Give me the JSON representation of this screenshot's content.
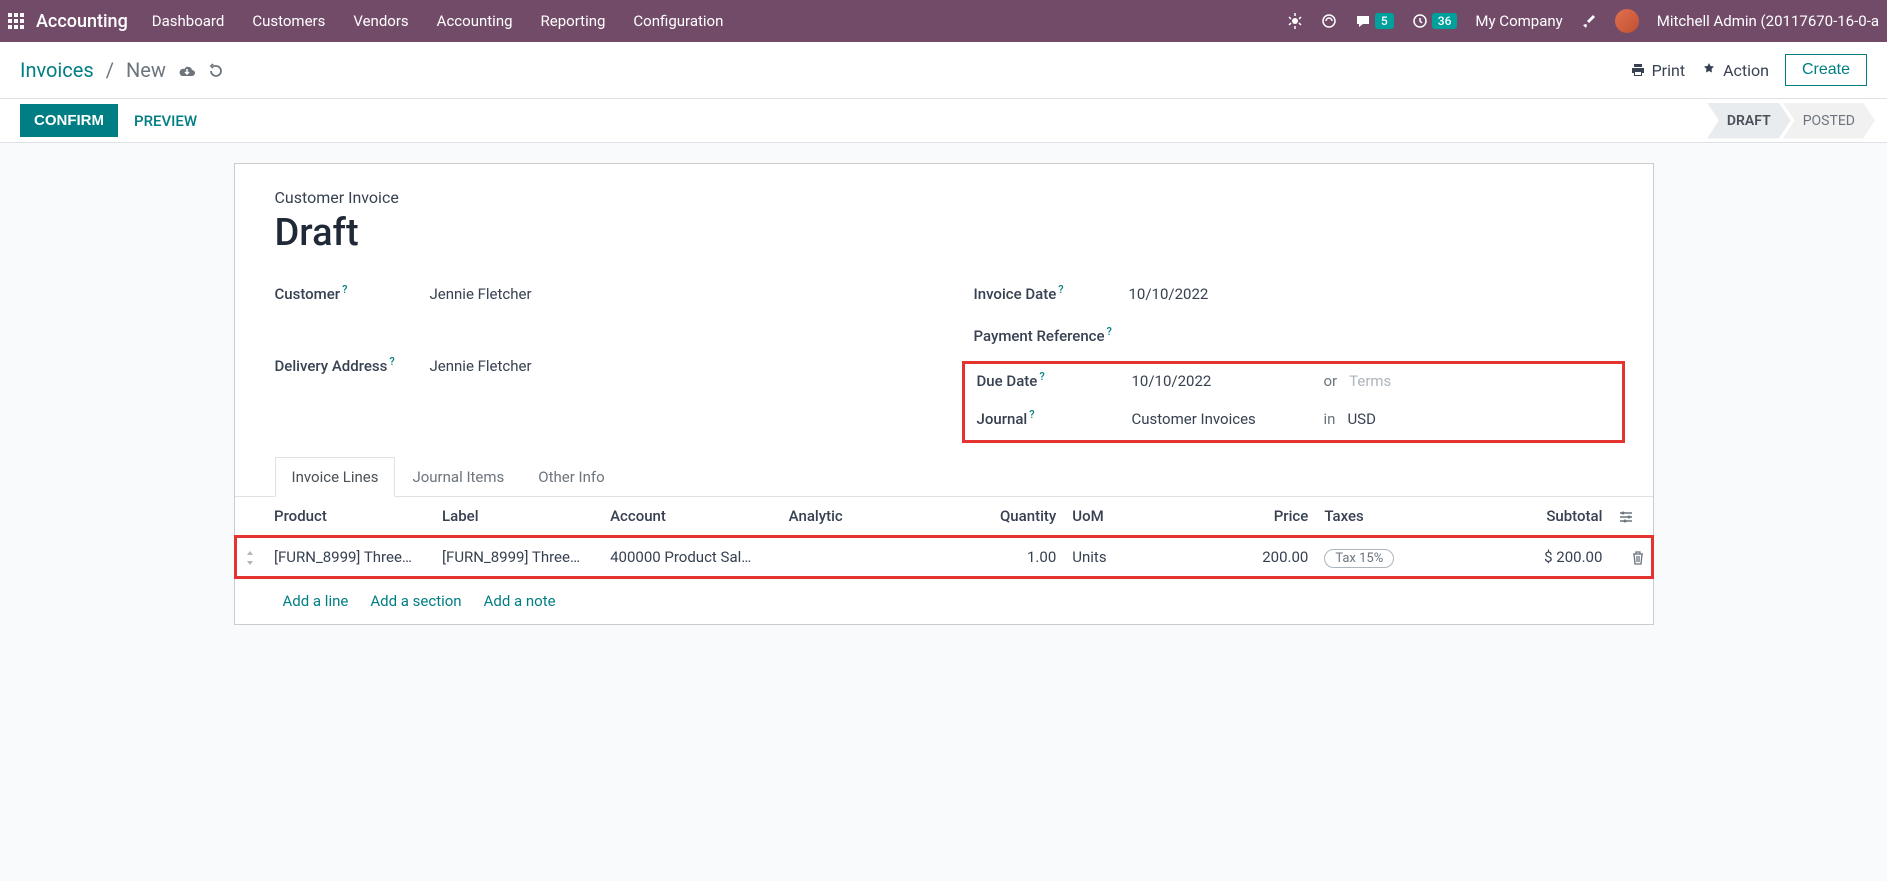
{
  "topbar": {
    "app_name": "Accounting",
    "menu": [
      "Dashboard",
      "Customers",
      "Vendors",
      "Accounting",
      "Reporting",
      "Configuration"
    ],
    "messages_badge": "5",
    "activities_badge": "36",
    "company": "My Company",
    "user": "Mitchell Admin (20117670-16-0-a"
  },
  "breadcrumb": {
    "parent": "Invoices",
    "current": "New",
    "print": "Print",
    "action": "Action",
    "create": "Create"
  },
  "statusbar": {
    "confirm": "CONFIRM",
    "preview": "PREVIEW",
    "steps": [
      "DRAFT",
      "POSTED"
    ]
  },
  "form": {
    "type": "Customer Invoice",
    "title": "Draft",
    "left": {
      "customer_label": "Customer",
      "customer_value": "Jennie Fletcher",
      "delivery_label": "Delivery Address",
      "delivery_value": "Jennie Fletcher"
    },
    "right": {
      "invoice_date_label": "Invoice Date",
      "invoice_date_value": "10/10/2022",
      "payment_ref_label": "Payment Reference",
      "payment_ref_value": "",
      "due_date_label": "Due Date",
      "due_date_value": "10/10/2022",
      "or": "or",
      "terms_placeholder": "Terms",
      "journal_label": "Journal",
      "journal_value": "Customer Invoices",
      "in": "in",
      "currency": "USD"
    }
  },
  "tabs": [
    "Invoice Lines",
    "Journal Items",
    "Other Info"
  ],
  "table": {
    "headers": {
      "product": "Product",
      "label": "Label",
      "account": "Account",
      "analytic": "Analytic",
      "quantity": "Quantity",
      "uom": "UoM",
      "price": "Price",
      "taxes": "Taxes",
      "subtotal": "Subtotal"
    },
    "rows": [
      {
        "product": "[FURN_8999] Three…",
        "label": "[FURN_8999] Three…",
        "account": "400000 Product Sal…",
        "analytic": "",
        "quantity": "1.00",
        "uom": "Units",
        "price": "200.00",
        "tax": "Tax 15%",
        "subtotal": "$ 200.00"
      }
    ]
  },
  "footer_links": {
    "add_line": "Add a line",
    "add_section": "Add a section",
    "add_note": "Add a note"
  }
}
